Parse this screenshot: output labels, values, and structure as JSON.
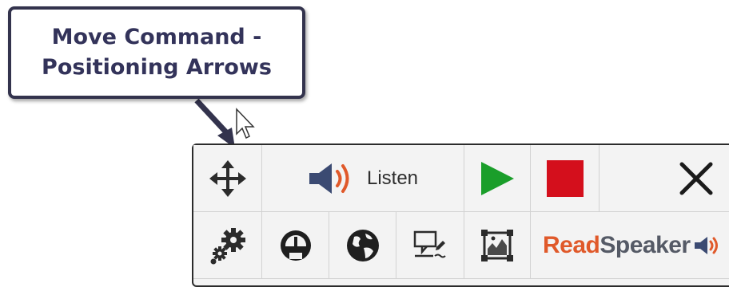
{
  "callout": {
    "line1": "Move Command -",
    "line2": "Positioning Arrows"
  },
  "toolbar": {
    "listen_label": "Listen",
    "brand": {
      "read": "Read",
      "speaker": "Speaker"
    },
    "icons": {
      "move": "move-arrows-icon",
      "speaker": "speaker-icon",
      "play": "play-icon",
      "stop": "stop-icon",
      "close": "close-icon",
      "settings": "gears-icon",
      "speed": "speedometer-icon",
      "language": "globe-icon",
      "translate": "text-edit-icon",
      "image": "image-icon"
    }
  },
  "colors": {
    "play": "#1a9e2a",
    "stop": "#d40f1c",
    "brand_orange": "#e0592a",
    "callout_text": "#33335a"
  }
}
